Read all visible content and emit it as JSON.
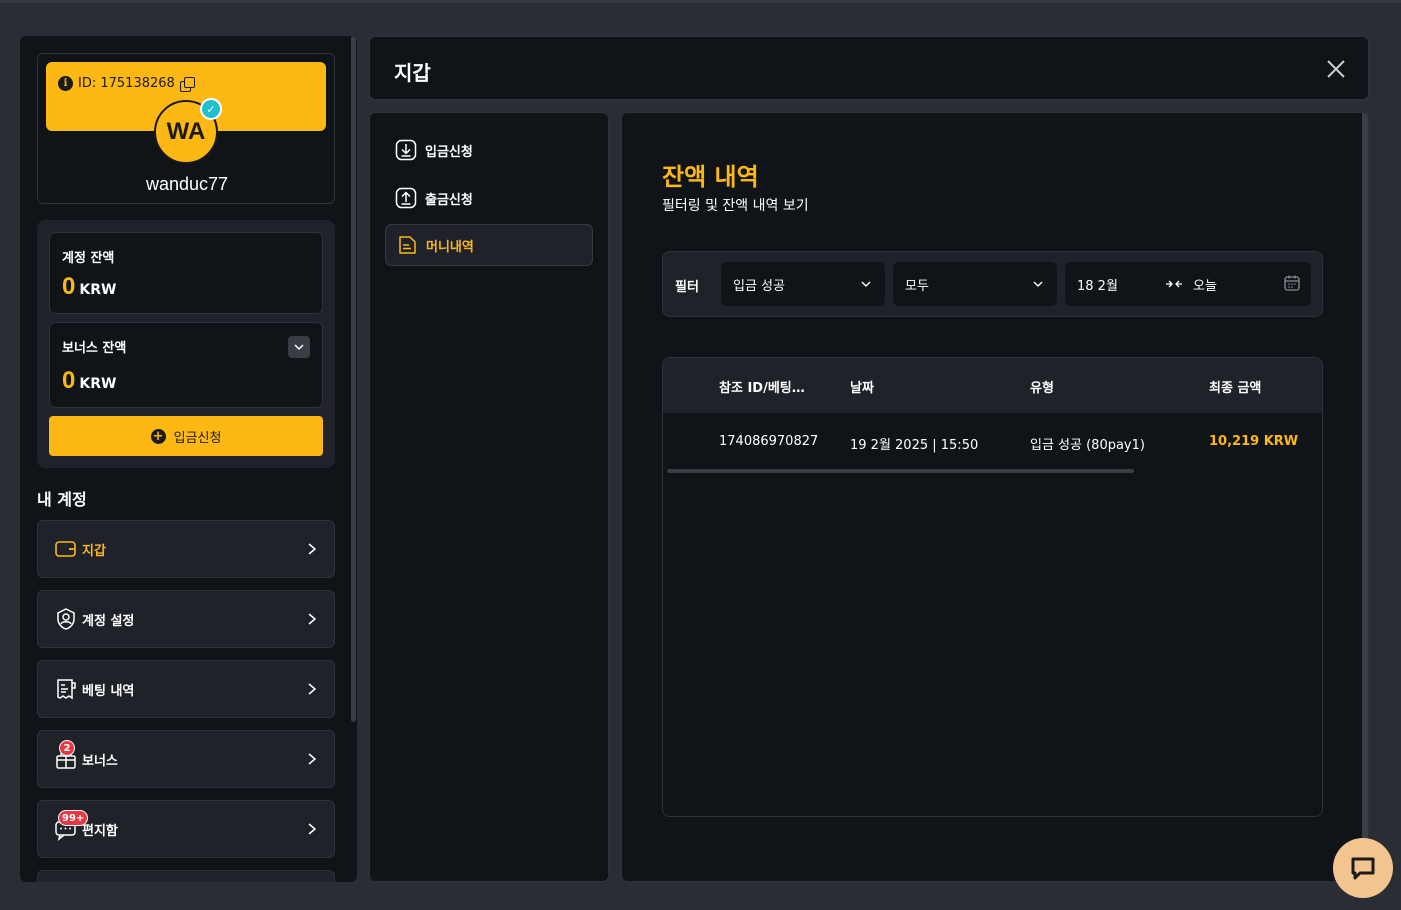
{
  "profile": {
    "id_label": "ID: 175138268",
    "avatar_initials": "WA",
    "username": "wanduc77"
  },
  "balances": {
    "account": {
      "label": "계정 잔액",
      "value": "0",
      "currency": "KRW"
    },
    "bonus": {
      "label": "보너스 잔액",
      "value": "0",
      "currency": "KRW"
    },
    "deposit_button": "입금신청"
  },
  "my_account": {
    "title": "내 계정",
    "items": [
      {
        "label": "지갑",
        "icon": "wallet-icon",
        "active": true
      },
      {
        "label": "계정 설정",
        "icon": "user-settings-icon"
      },
      {
        "label": "베팅 내역",
        "icon": "receipt-icon"
      },
      {
        "label": "보너스",
        "icon": "gift-icon",
        "badge": "2"
      },
      {
        "label": "편지함",
        "icon": "message-icon",
        "badge": "99+"
      }
    ]
  },
  "wallet": {
    "title": "지갑",
    "nav": [
      {
        "label": "입금신청",
        "icon": "download-icon"
      },
      {
        "label": "출금신청",
        "icon": "upload-icon"
      },
      {
        "label": "머니내역",
        "icon": "document-icon",
        "active": true
      }
    ]
  },
  "history": {
    "title": "잔액 내역",
    "subtitle": "필터링 및 잔액 내역 보기",
    "filter": {
      "label": "필터",
      "type_value": "입금 성공",
      "scope_value": "모두",
      "date_from": "18 2월",
      "date_to": "오늘"
    },
    "columns": [
      "참조 ID/베팅…",
      "날짜",
      "유형",
      "최종 금액"
    ],
    "rows": [
      {
        "ref": "174086970827",
        "date": "19 2월 2025 | 15:50",
        "type": "입금 성공 (80pay1)",
        "amount": "10,219 KRW"
      }
    ]
  },
  "colors": {
    "accent": "#fdb813",
    "panel": "#101419",
    "card": "#1f2228",
    "chat": "#f2c590"
  }
}
